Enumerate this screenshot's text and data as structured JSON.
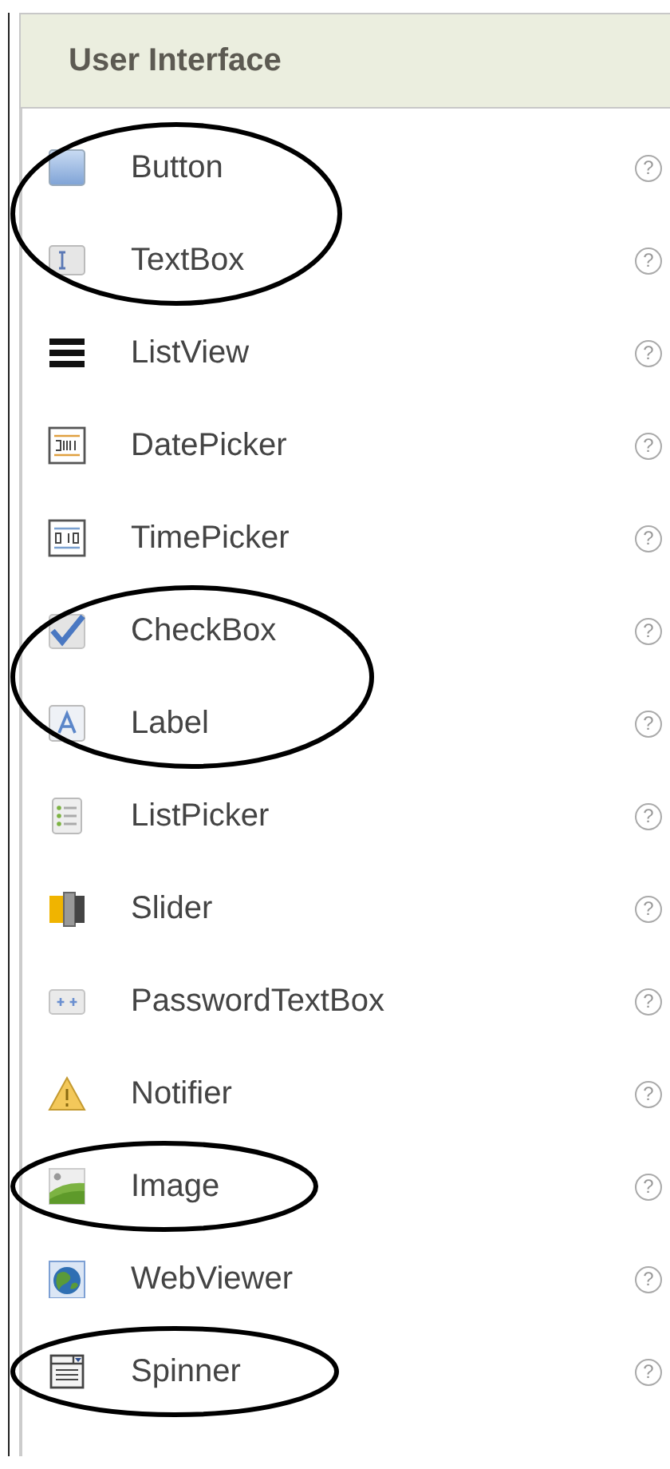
{
  "panel": {
    "title": "User Interface"
  },
  "items": [
    {
      "label": "Button",
      "kind": "button",
      "help": "?",
      "circled": true
    },
    {
      "label": "TextBox",
      "kind": "textbox",
      "help": "?",
      "circled": true
    },
    {
      "label": "ListView",
      "kind": "listview",
      "help": "?",
      "circled": false
    },
    {
      "label": "DatePicker",
      "kind": "datepicker",
      "help": "?",
      "circled": false
    },
    {
      "label": "TimePicker",
      "kind": "timepicker",
      "help": "?",
      "circled": false
    },
    {
      "label": "CheckBox",
      "kind": "checkbox",
      "help": "?",
      "circled": true
    },
    {
      "label": "Label",
      "kind": "label",
      "help": "?",
      "circled": true
    },
    {
      "label": "ListPicker",
      "kind": "listpicker",
      "help": "?",
      "circled": false
    },
    {
      "label": "Slider",
      "kind": "slider",
      "help": "?",
      "circled": false
    },
    {
      "label": "PasswordTextBox",
      "kind": "password",
      "help": "?",
      "circled": false
    },
    {
      "label": "Notifier",
      "kind": "notifier",
      "help": "?",
      "circled": false
    },
    {
      "label": "Image",
      "kind": "image",
      "help": "?",
      "circled": true
    },
    {
      "label": "WebViewer",
      "kind": "webviewer",
      "help": "?",
      "circled": false
    },
    {
      "label": "Spinner",
      "kind": "spinner",
      "help": "?",
      "circled": true
    }
  ]
}
